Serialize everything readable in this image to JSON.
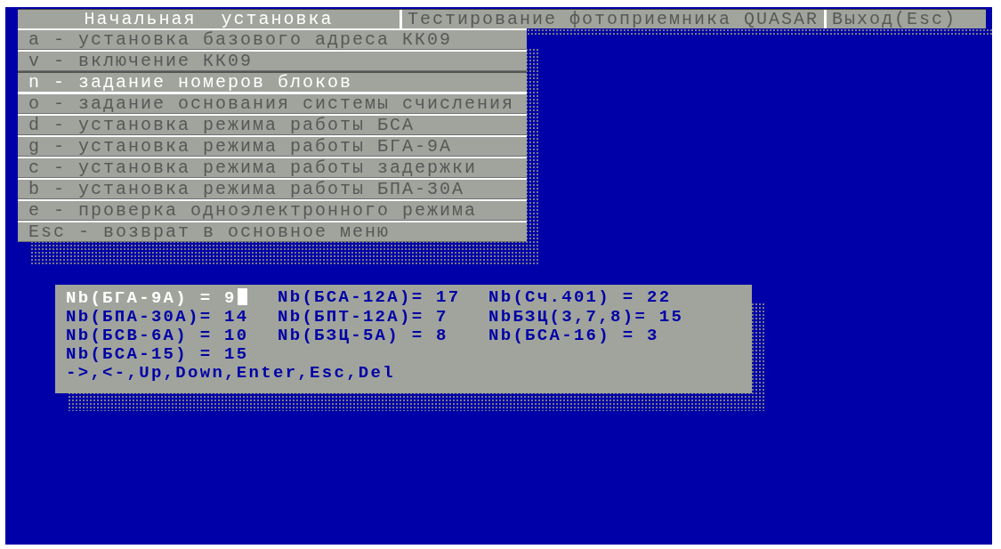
{
  "menu_bar": [
    {
      "label": "Начальная  установка",
      "selected": true
    },
    {
      "label": "Тестирование фотоприемника QUASAR",
      "selected": false
    },
    {
      "label": "Выход(Esc)",
      "selected": false
    }
  ],
  "dropdown": {
    "items": [
      {
        "label": "a - установка базового адреса КК09",
        "selected": false
      },
      {
        "label": "v - включение КК09",
        "selected": false
      },
      {
        "label": "n - задание номеров блоков",
        "selected": true
      },
      {
        "label": "o - задание основания системы счисления",
        "selected": false
      },
      {
        "label": "d - установка режима работы БСА",
        "selected": false
      },
      {
        "label": "g - установка режима работы БГА-9А",
        "selected": false
      },
      {
        "label": "c - установка режима работы задержки",
        "selected": false
      },
      {
        "label": "b - установка режима работы БПА-30А",
        "selected": false
      },
      {
        "label": "e - проверка одноэлектронного режима",
        "selected": false
      },
      {
        "label": "Esc - возврат в основное меню",
        "selected": false
      }
    ]
  },
  "block_numbers": {
    "entries": [
      {
        "label": "Nb(БГА-9А) = 9",
        "selected": true
      },
      {
        "label": "Nb(БСА-12А)= 17",
        "selected": false
      },
      {
        "label": "Nb(Сч.401) = 22",
        "selected": false
      },
      {
        "label": "Nb(БПА-30А)= 14",
        "selected": false
      },
      {
        "label": "Nb(БПТ-12А)= 7",
        "selected": false
      },
      {
        "label": "NbБЗЦ(3,7,8)= 15",
        "selected": false
      },
      {
        "label": "Nb(БСВ-6А) = 10",
        "selected": false
      },
      {
        "label": "Nb(БЗЦ-5А) = 8",
        "selected": false
      },
      {
        "label": "Nb(БСА-16) = 3",
        "selected": false
      },
      {
        "label": "Nb(БСА-15) = 15",
        "selected": false
      }
    ],
    "hint": "->,<-,Up,Down,Enter,Esc,Del"
  }
}
